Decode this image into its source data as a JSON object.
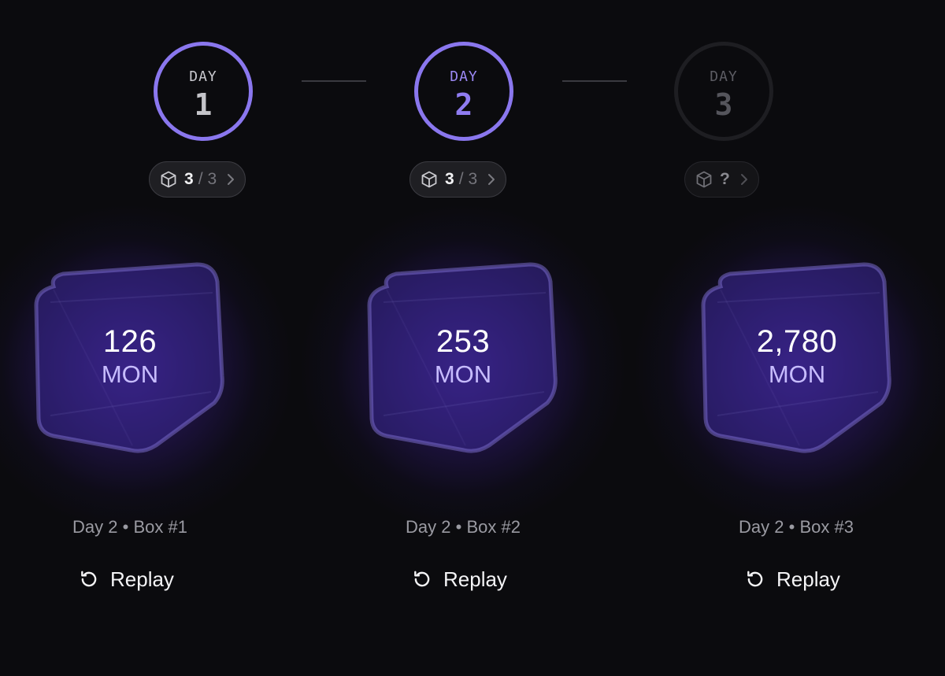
{
  "days": [
    {
      "label": "DAY",
      "number": "1",
      "status": "complete",
      "boxes_opened": "3",
      "separator": "/",
      "boxes_total": "3"
    },
    {
      "label": "DAY",
      "number": "2",
      "status": "current",
      "boxes_opened": "3",
      "separator": "/",
      "boxes_total": "3"
    },
    {
      "label": "DAY",
      "number": "3",
      "status": "locked",
      "boxes_unknown": "?"
    }
  ],
  "boxes": [
    {
      "amount": "126",
      "currency": "MON",
      "caption": "Day 2 • Box #1",
      "replay_label": "Replay"
    },
    {
      "amount": "253",
      "currency": "MON",
      "caption": "Day 2 • Box #2",
      "replay_label": "Replay"
    },
    {
      "amount": "2,780",
      "currency": "MON",
      "caption": "Day 2 • Box #3",
      "replay_label": "Replay"
    }
  ],
  "colors": {
    "accent": "#8a77ee",
    "background": "#0b0b0e",
    "currency": "#c7bcff",
    "locked": "#1e1e22"
  },
  "icons": {
    "pill": "cube-icon",
    "pill_arrow": "chevron-right-icon",
    "replay": "replay-icon"
  }
}
